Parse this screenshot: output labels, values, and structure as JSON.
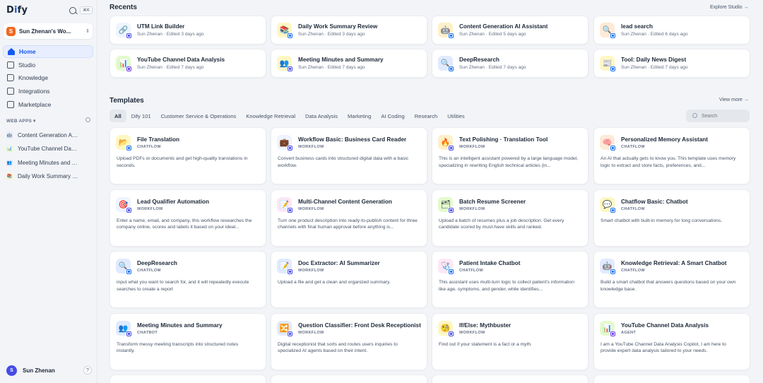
{
  "brand": {
    "logo_pre": "D",
    "logo_i": "i",
    "logo_post": "fy",
    "shortcut": "⌘K"
  },
  "workspace": {
    "initial": "S",
    "name": "Sun Zhenan's Wo..."
  },
  "nav": [
    {
      "label": "Home",
      "icon": "home-icon",
      "active": true
    },
    {
      "label": "Studio",
      "icon": "studio-icon"
    },
    {
      "label": "Knowledge",
      "icon": "knowledge-icon"
    },
    {
      "label": "Integrations",
      "icon": "integrations-icon"
    },
    {
      "label": "Marketplace",
      "icon": "marketplace-icon"
    }
  ],
  "web_apps_heading": "WEB APPS ▾",
  "web_apps": [
    {
      "label": "Content Generation AI ...",
      "icon": "🤖",
      "color": "#e0eaff"
    },
    {
      "label": "YouTube Channel Data...",
      "icon": "📊",
      "color": "#e3fbcc"
    },
    {
      "label": "Meeting Minutes and S...",
      "icon": "👥",
      "color": "#e0eaff"
    },
    {
      "label": "Daily Work Summary R...",
      "icon": "📚",
      "color": "#fef0c7"
    }
  ],
  "user": {
    "initial": "S",
    "name": "Sun Zhenan",
    "help": "?"
  },
  "recents": {
    "title": "Recents",
    "explore_link": "Explore Studio →",
    "items": [
      {
        "title": "UTM Link Builder",
        "meta": "Sun Zhenan · Edited 3 days ago",
        "icon": "🔗",
        "bg": "#eef4ff",
        "mini": "wf"
      },
      {
        "title": "Daily Work Summary Review",
        "meta": "Sun Zhenan · Edited 3 days ago",
        "icon": "📚",
        "bg": "#fef7c3",
        "mini": "chat"
      },
      {
        "title": "Content Generation AI Assistant",
        "meta": "Sun Zhenan · Edited 5 days ago",
        "icon": "🤖",
        "bg": "#fef0c7",
        "mini": "chat"
      },
      {
        "title": "lead search",
        "meta": "Sun Zhenan · Edited 6 days ago",
        "icon": "🔍",
        "bg": "#fdead7",
        "mini": "chat"
      },
      {
        "title": "YouTube Channel Data Analysis",
        "meta": "Sun Zhenan · Edited 7 days ago",
        "icon": "📊",
        "bg": "#e3fbcc",
        "mini": "agent"
      },
      {
        "title": "Meeting Minutes and Summary",
        "meta": "Sun Zhenan · Edited 7 days ago",
        "icon": "👥",
        "bg": "#fef7c3",
        "mini": "wf"
      },
      {
        "title": "DeepResearch",
        "meta": "Sun Zhenan · Edited 7 days ago",
        "icon": "🔍",
        "bg": "#e0eaff",
        "mini": "chat"
      },
      {
        "title": "Tool: Daily News Digest",
        "meta": "Sun Zhenan · Edited 7 days ago",
        "icon": "📰",
        "bg": "#fef7c3",
        "mini": "chat"
      }
    ]
  },
  "templates": {
    "title": "Templates",
    "view_more": "View more →",
    "filters": [
      "All",
      "Dify 101",
      "Customer Service & Operations",
      "Knowledge Retrieval",
      "Data Analysis",
      "Marketing",
      "AI Coding",
      "Research",
      "Utilities"
    ],
    "search_placeholder": "Search",
    "items": [
      {
        "title": "File Translation",
        "type": "CHATFLOW",
        "desc": "Upload PDFs or documents and get high-quality translations in seconds.",
        "icon": "📂",
        "bg": "#fef7c3",
        "mini": "chat"
      },
      {
        "title": "Workflow Basic: Business Card Reader",
        "type": "WORKFLOW",
        "desc": "Convert business cards into structured digital data with a basic workflow.",
        "icon": "💼",
        "bg": "#eef4ff",
        "mini": "wf"
      },
      {
        "title": "Text Polishing · Translation Tool",
        "type": "WORKFLOW",
        "desc": "This is an intelligent assistant powered by a large language model, specializing in rewriting English technical articles (in...",
        "icon": "🔥",
        "bg": "#fef0c7",
        "mini": "wf"
      },
      {
        "title": "Personalized Memory Assistant",
        "type": "CHATFLOW",
        "desc": "An AI that actually gets to know you. This template uses memory logic to extract and store facts, preferences, and...",
        "icon": "🧠",
        "bg": "#fdead7",
        "mini": "chat"
      },
      {
        "title": "Lead Qualifier Automation",
        "type": "WORKFLOW",
        "desc": "Enter a name, email, and company, this workflow researches the company online, scores and labels it based on your ideal...",
        "icon": "🎯",
        "bg": "#eef4ff",
        "mini": "wf"
      },
      {
        "title": "Multi-Channel Content Generation",
        "type": "WORKFLOW",
        "desc": "Turn one product description into ready-to-publish content for three channels with final human approval before anything is...",
        "icon": "📝",
        "bg": "#fce7f6",
        "mini": "wf"
      },
      {
        "title": "Batch Resume Screener",
        "type": "WORKFLOW",
        "desc": "Upload a batch of resumes plus a job description. Get every candidate scored by must-have skills and ranked.",
        "icon": "🗂",
        "bg": "#e3fbcc",
        "mini": "wf"
      },
      {
        "title": "Chatflow Basic: Chatbot",
        "type": "CHATFLOW",
        "desc": "Smart chatbot with built-in memory for long conversations.",
        "icon": "💬",
        "bg": "#fef7c3",
        "mini": "chat"
      },
      {
        "title": "DeepResearch",
        "type": "CHATFLOW",
        "desc": "input what you want to search for, and it will repeatedly execute searches to create a report",
        "icon": "🔍",
        "bg": "#e0eaff",
        "mini": "chat"
      },
      {
        "title": "Doc Extractor: AI Summarizer",
        "type": "WORKFLOW",
        "desc": "Upload a file and get a clean and organized summary.",
        "icon": "📝",
        "bg": "#e0eaff",
        "mini": "wf"
      },
      {
        "title": "Patient Intake Chatbot",
        "type": "CHATFLOW",
        "desc": "This assistant uses multi-turn logic to collect patient's information like age, symptoms, and gender, while identifies...",
        "icon": "🩺",
        "bg": "#fce7f6",
        "mini": "chat"
      },
      {
        "title": "Knowledge Retrieval: A Smart Chatbot",
        "type": "CHATFLOW",
        "desc": "Build a smart chatbot that answers questions based on your own knowledge base.",
        "icon": "🤖",
        "bg": "#e0eaff",
        "mini": "chat"
      },
      {
        "title": "Meeting Minutes and Summary",
        "type": "CHATBOT",
        "desc": "Transform messy meeting transcripts into structured notes instantly.",
        "icon": "👥",
        "bg": "#e0eaff",
        "mini": "wf"
      },
      {
        "title": "Question Classifier: Front Desk Receptionist",
        "type": "WORKFLOW",
        "desc": "Digital receptionist that sorts and routes users inquiries to specialized AI agents based on their intent.",
        "icon": "🔀",
        "bg": "#e0eaff",
        "mini": "wf"
      },
      {
        "title": "If/Else: Mythbuster",
        "type": "WORKFLOW",
        "desc": "Find out if your statement is a fact or a myth.",
        "icon": "🧐",
        "bg": "#fef7c3",
        "mini": "wf"
      },
      {
        "title": "YouTube Channel Data Analysis",
        "type": "AGENT",
        "desc": "I am a YouTube Channel Data Analysis Copilot, I am here to provide expert data analysis tailored to your needs.",
        "icon": "📊",
        "bg": "#e3fbcc",
        "mini": "agent"
      }
    ]
  }
}
